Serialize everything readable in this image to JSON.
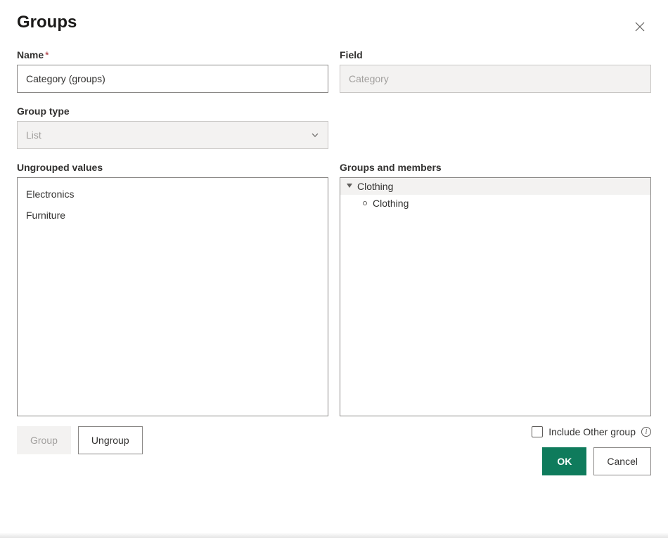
{
  "dialog": {
    "title": "Groups"
  },
  "fields": {
    "name_label": "Name",
    "name_required": "*",
    "name_value": "Category (groups)",
    "field_label": "Field",
    "field_value": "Category",
    "group_type_label": "Group type",
    "group_type_value": "List",
    "ungrouped_label": "Ungrouped values",
    "ungrouped_values": [
      "Electronics",
      "Furniture"
    ],
    "groups_members_label": "Groups and members",
    "groups": [
      {
        "name": "Clothing",
        "members": [
          "Clothing"
        ]
      }
    ]
  },
  "buttons": {
    "group": "Group",
    "ungroup": "Ungroup",
    "include_other_label": "Include Other group",
    "ok": "OK",
    "cancel": "Cancel"
  }
}
